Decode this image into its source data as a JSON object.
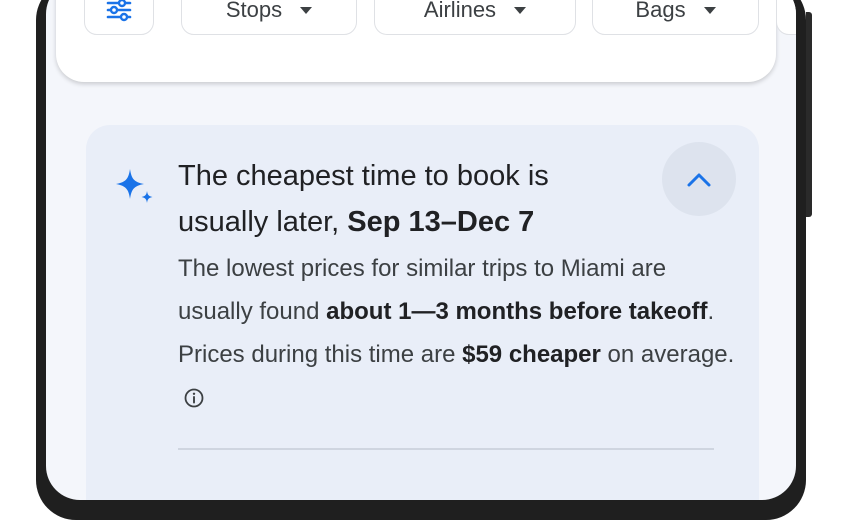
{
  "filters": {
    "chips": [
      {
        "label": "Stops"
      },
      {
        "label": "Airlines"
      },
      {
        "label": "Bags"
      }
    ]
  },
  "insight": {
    "headline_prefix": "The cheapest time to book is usually later, ",
    "headline_range": "Sep 13–Dec 7",
    "body_1": "The lowest prices for similar trips to Miami are usually found ",
    "body_bold_1": "about 1—3 months before takeoff",
    "body_2": ". Prices during this time are ",
    "body_bold_2": "$59 cheaper",
    "body_3": " on average."
  },
  "colors": {
    "accent_blue": "#1a73e8",
    "card_background": "#e9eef8"
  },
  "icons": {
    "filter": "tune-icon",
    "sparkle": "sparkle-icon",
    "collapse": "chevron-up-icon",
    "info": "info-icon",
    "dropdown": "caret-down-icon"
  }
}
